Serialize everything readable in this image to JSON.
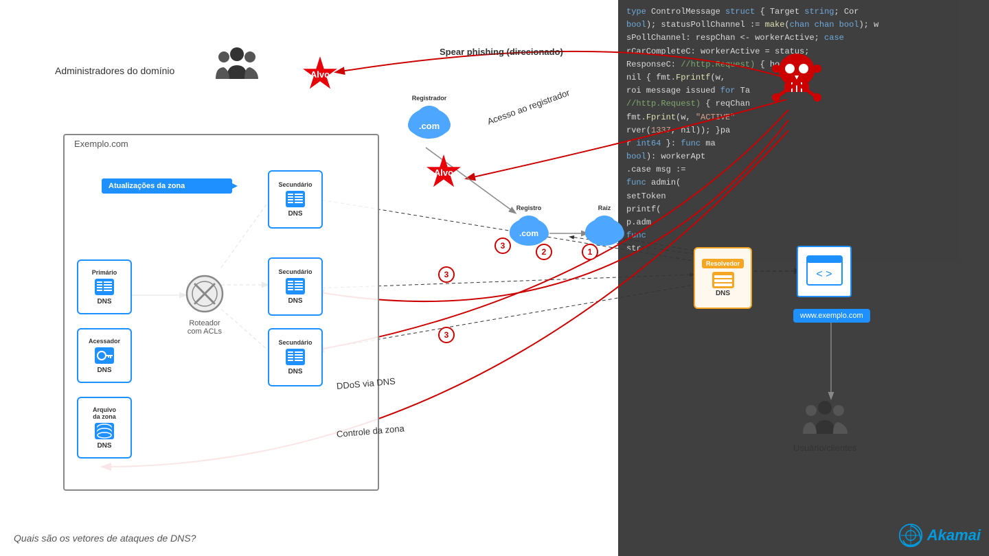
{
  "title": "Quais são os vetores de ataques de DNS?",
  "brand": "Akamai",
  "labels": {
    "admins": "Administradores do domínio",
    "alvo": "Alvo",
    "spear_phishing": "Spear phishing (direcionado)",
    "acesso_registrador": "Acesso ao registrador",
    "registrador": "Registrador",
    "registro": "Registro",
    "raiz": "Raiz",
    "resolvedor": "Resolvedor",
    "exemplo_com": "Exemplo.com",
    "primario": "Primário",
    "secundario": "Secundário",
    "acessador": "Acessador",
    "arquivo_zona": "Arquivo\nda zona",
    "zone_updates": "Atualizações da zona",
    "roteador": "Roteador\ncom ACLs",
    "ddos": "DDoS via DNS",
    "controle_zona": "Controle da zona",
    "usuarios": "Usuário/clientes",
    "www": "www.exemplo.com",
    "dns": "DNS",
    "bottom_label": "Quais são os vetores de ataques de DNS?",
    "num1": "①",
    "num2": "②",
    "num3": "③"
  },
  "code_lines": [
    "type ControlMessage struct { Target string; Cor",
    "bool); statusPollChannel := make(chan chan bool); w",
    "sPollChannel: respChan <- workerActive; case",
    "rCarCompleteC: workerActive = status;",
    "ResponseC: //http.Request) { hostToL",
    "nil { fmt.Fprintf(w,",
    "roi message issued for Ta",
    "//http.Request) { reqChan",
    "fmt.Fprint(w, \"ACTIVE\"",
    "rver(1337, nil)); }pa",
    "r int64 }: func ma",
    "bool): workerApt",
    ".case msg :=",
    "func admin(",
    "setToken",
    "printf(",
    "p.adm",
    "func",
    "str"
  ],
  "colors": {
    "blue": "#1e90ff",
    "red": "#cc0000",
    "orange": "#f5a623",
    "dark_red": "#e8000a",
    "gray": "#888888",
    "text": "#333333"
  }
}
